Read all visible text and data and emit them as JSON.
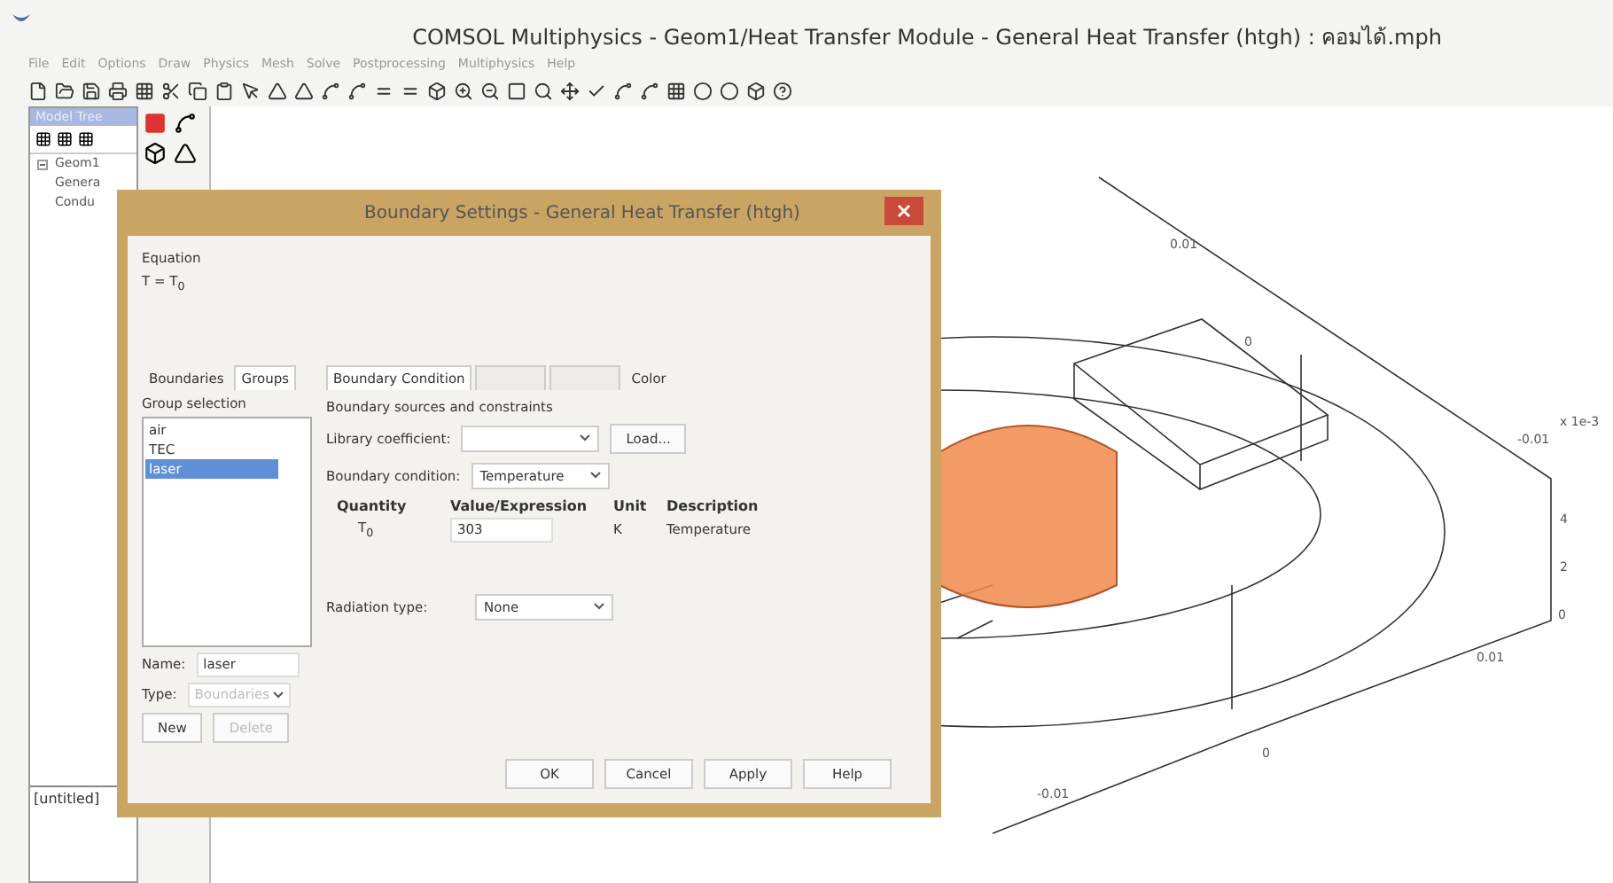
{
  "window": {
    "title": "COMSOL Multiphysics - Geom1/Heat Transfer Module - General Heat Transfer (htgh) : คอมได้.mph"
  },
  "menu": [
    "File",
    "Edit",
    "Options",
    "Draw",
    "Physics",
    "Mesh",
    "Solve",
    "Postprocessing",
    "Multiphysics",
    "Help"
  ],
  "model_tree": {
    "header": "Model Tree",
    "items": [
      {
        "label": "Geom1",
        "expanded": true,
        "children": [
          {
            "label": "Genera"
          },
          {
            "label": "Condu"
          }
        ]
      }
    ],
    "footer": "[untitled]"
  },
  "canvas": {
    "labels": [
      "0.01",
      "0",
      "x 1e-3",
      "-0.01",
      "4",
      "2",
      "0",
      "0.01",
      "0",
      "-0.01"
    ]
  },
  "dialog": {
    "title": "Boundary Settings - General Heat Transfer (htgh)",
    "equation_label": "Equation",
    "equation": "T = T$_{0}$",
    "left_tabs": [
      {
        "label": "Boundaries",
        "selected": false
      },
      {
        "label": "Groups",
        "selected": true
      }
    ],
    "group_label": "Group selection",
    "groups": [
      {
        "label": "air",
        "selected": false
      },
      {
        "label": "TEC",
        "selected": false
      },
      {
        "label": "laser",
        "selected": true
      }
    ],
    "name_label": "Name:",
    "name_value": "laser",
    "type_label": "Type:",
    "type_value": "Boundaries",
    "type_disabled": true,
    "group_buttons": [
      {
        "label": "New",
        "disabled": false
      },
      {
        "label": "Delete",
        "disabled": true
      }
    ],
    "right_tabs": [
      {
        "label": "Boundary Condition",
        "selected": true,
        "disabled": false
      },
      {
        "selected": false,
        "disabled": true
      },
      {
        "selected": false,
        "disabled": true
      },
      {
        "label": "Color",
        "selected": false,
        "disabled": false
      }
    ],
    "section": "Boundary sources and constraints",
    "library_label": "Library coefficient:",
    "load_button": "Load...",
    "condition_label": "Boundary condition:",
    "condition_value": "Temperature",
    "columns": [
      "Quantity",
      "Value/Expression",
      "Unit",
      "Description"
    ],
    "rows": [
      {
        "quantity": "T$_{0}$",
        "value": "303",
        "unit": "K",
        "description": "Temperature"
      }
    ],
    "radiation_label": "Radiation type:",
    "radiation_value": "None",
    "buttons": [
      "OK",
      "Cancel",
      "Apply",
      "Help"
    ]
  }
}
